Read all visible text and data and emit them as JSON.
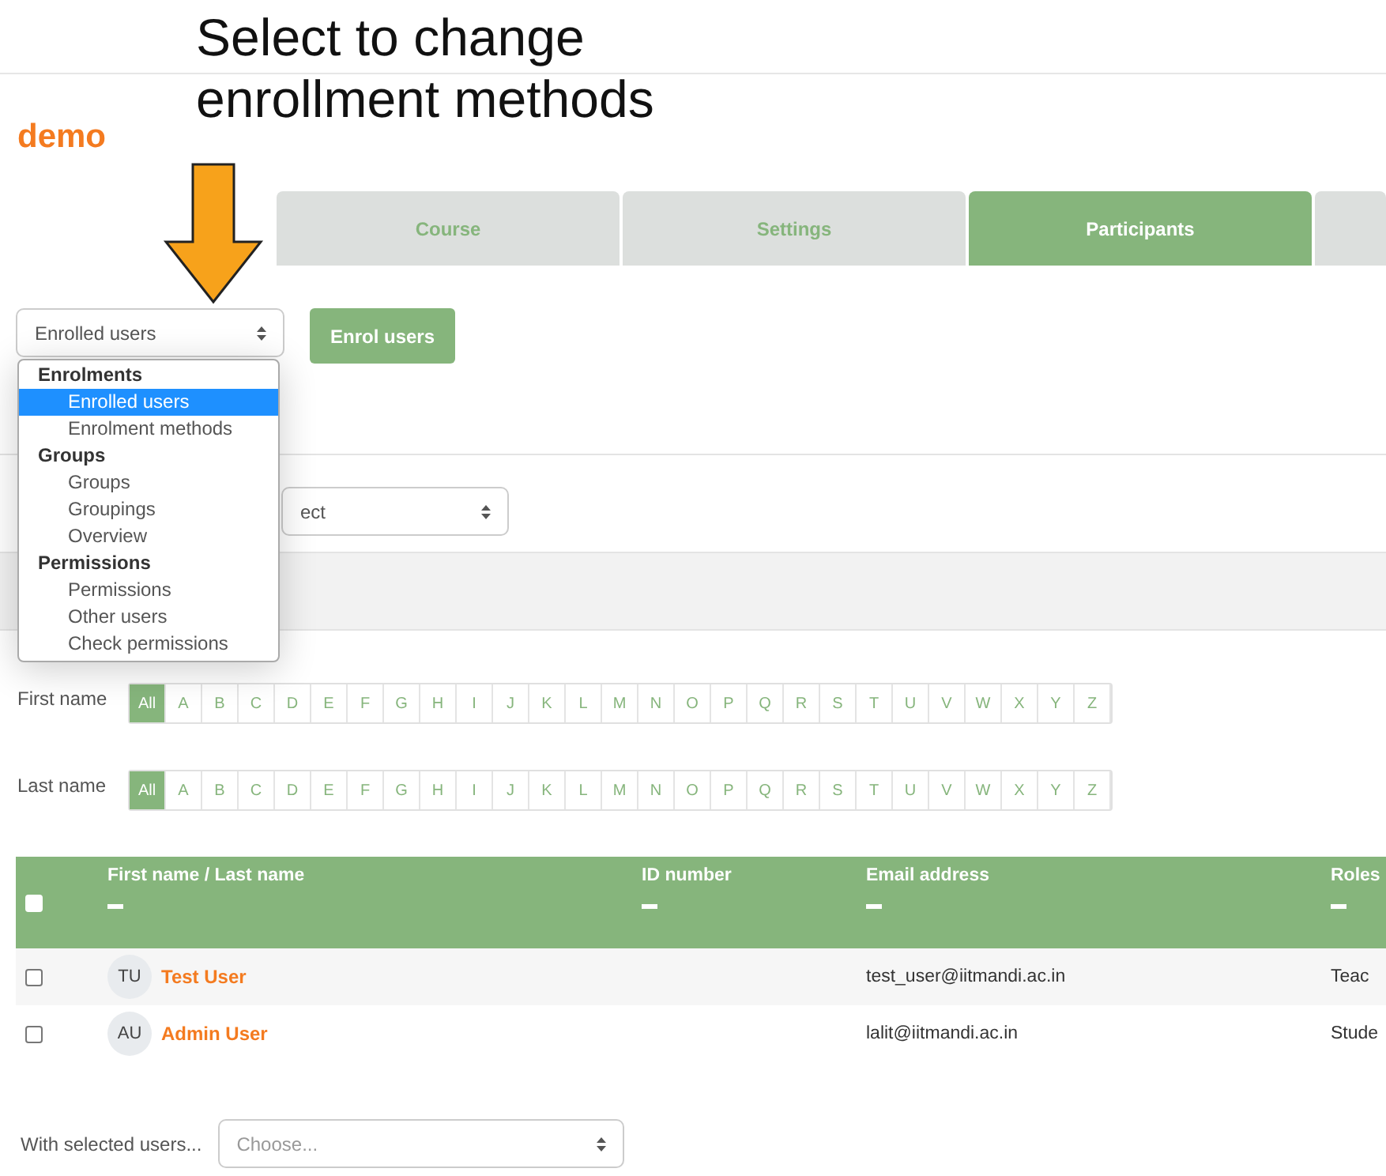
{
  "annotation": {
    "text": "Select to change enrollment methods"
  },
  "site": {
    "title": "demo"
  },
  "tabs": [
    {
      "label": "Course",
      "selected": false
    },
    {
      "label": "Settings",
      "selected": false
    },
    {
      "label": "Participants",
      "selected": true
    }
  ],
  "view_select": {
    "value": "Enrolled users",
    "expanded": true,
    "groups": [
      {
        "label": "Enrolments",
        "options": [
          {
            "label": "Enrolled users",
            "selected": true
          },
          {
            "label": "Enrolment methods",
            "selected": false
          }
        ]
      },
      {
        "label": "Groups",
        "options": [
          {
            "label": "Groups",
            "selected": false
          },
          {
            "label": "Groupings",
            "selected": false
          },
          {
            "label": "Overview",
            "selected": false
          }
        ]
      },
      {
        "label": "Permissions",
        "options": [
          {
            "label": "Permissions",
            "selected": false
          },
          {
            "label": "Other users",
            "selected": false
          },
          {
            "label": "Check permissions",
            "selected": false
          }
        ]
      }
    ]
  },
  "enrol_button": {
    "label": "Enrol users"
  },
  "filter_select": {
    "value": "ect"
  },
  "initials_filters": [
    {
      "label": "First name",
      "letters": [
        {
          "label": "All",
          "selected": true
        },
        {
          "label": "A",
          "selected": false
        },
        {
          "label": "B",
          "selected": false
        },
        {
          "label": "C",
          "selected": false
        },
        {
          "label": "D",
          "selected": false
        },
        {
          "label": "E",
          "selected": false
        },
        {
          "label": "F",
          "selected": false
        },
        {
          "label": "G",
          "selected": false
        },
        {
          "label": "H",
          "selected": false
        },
        {
          "label": "I",
          "selected": false
        },
        {
          "label": "J",
          "selected": false
        },
        {
          "label": "K",
          "selected": false
        },
        {
          "label": "L",
          "selected": false
        },
        {
          "label": "M",
          "selected": false
        },
        {
          "label": "N",
          "selected": false
        },
        {
          "label": "O",
          "selected": false
        },
        {
          "label": "P",
          "selected": false
        },
        {
          "label": "Q",
          "selected": false
        },
        {
          "label": "R",
          "selected": false
        },
        {
          "label": "S",
          "selected": false
        },
        {
          "label": "T",
          "selected": false
        },
        {
          "label": "U",
          "selected": false
        },
        {
          "label": "V",
          "selected": false
        },
        {
          "label": "W",
          "selected": false
        },
        {
          "label": "X",
          "selected": false
        },
        {
          "label": "Y",
          "selected": false
        },
        {
          "label": "Z",
          "selected": false
        }
      ]
    },
    {
      "label": "Last name",
      "letters": [
        {
          "label": "All",
          "selected": true
        },
        {
          "label": "A",
          "selected": false
        },
        {
          "label": "B",
          "selected": false
        },
        {
          "label": "C",
          "selected": false
        },
        {
          "label": "D",
          "selected": false
        },
        {
          "label": "E",
          "selected": false
        },
        {
          "label": "F",
          "selected": false
        },
        {
          "label": "G",
          "selected": false
        },
        {
          "label": "H",
          "selected": false
        },
        {
          "label": "I",
          "selected": false
        },
        {
          "label": "J",
          "selected": false
        },
        {
          "label": "K",
          "selected": false
        },
        {
          "label": "L",
          "selected": false
        },
        {
          "label": "M",
          "selected": false
        },
        {
          "label": "N",
          "selected": false
        },
        {
          "label": "O",
          "selected": false
        },
        {
          "label": "P",
          "selected": false
        },
        {
          "label": "Q",
          "selected": false
        },
        {
          "label": "R",
          "selected": false
        },
        {
          "label": "S",
          "selected": false
        },
        {
          "label": "T",
          "selected": false
        },
        {
          "label": "U",
          "selected": false
        },
        {
          "label": "V",
          "selected": false
        },
        {
          "label": "W",
          "selected": false
        },
        {
          "label": "X",
          "selected": false
        },
        {
          "label": "Y",
          "selected": false
        },
        {
          "label": "Z",
          "selected": false
        }
      ]
    }
  ],
  "table": {
    "select_all": {
      "checked": false
    },
    "columns": [
      {
        "label": "First name / Last name"
      },
      {
        "label": "ID number"
      },
      {
        "label": "Email address"
      },
      {
        "label": "Roles"
      }
    ],
    "rows": [
      {
        "checked": false,
        "initials": "TU",
        "name": "Test User",
        "email": "test_user@iitmandi.ac.in",
        "roles": "Teac"
      },
      {
        "checked": false,
        "initials": "AU",
        "name": "Admin User",
        "email": "lalit@iitmandi.ac.in",
        "roles": "Stude"
      }
    ]
  },
  "bulk_action": {
    "label": "With selected users...",
    "placeholder": "Choose..."
  }
}
